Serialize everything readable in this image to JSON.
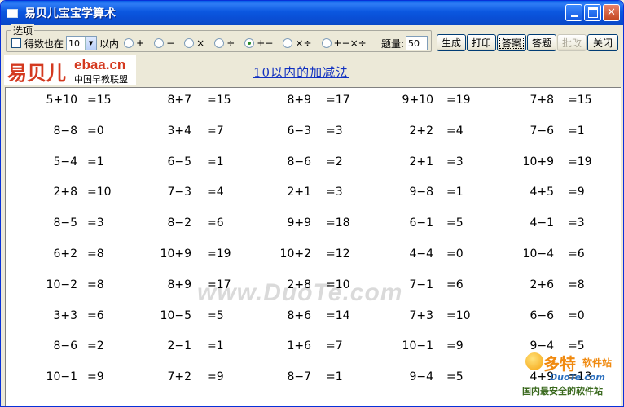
{
  "window": {
    "title": "易贝儿宝宝学算术"
  },
  "options": {
    "legend": "选项",
    "result_within_label": "得数也在",
    "limit_value": "10",
    "within_label": "以内",
    "ops": [
      {
        "label": "+",
        "selected": false
      },
      {
        "label": "−",
        "selected": false
      },
      {
        "label": "×",
        "selected": false
      },
      {
        "label": "÷",
        "selected": false
      },
      {
        "label": "+−",
        "selected": true
      },
      {
        "label": "×÷",
        "selected": false
      },
      {
        "label": "+−×÷",
        "selected": false
      }
    ],
    "count_label": "题量:",
    "count_value": "50"
  },
  "toolbar": {
    "generate": "生成",
    "print": "打印",
    "answer": "答案",
    "answer_questions": "答题",
    "grade": "批改",
    "close": "关闭"
  },
  "logo": {
    "cn": "易贝儿",
    "en": "ebaa.cn",
    "sub": "中国早教联盟"
  },
  "heading": "10以内的加减法",
  "problems": [
    [
      "5+10",
      "=15"
    ],
    [
      "8+7",
      "=15"
    ],
    [
      "8+9",
      "=17"
    ],
    [
      "9+10",
      "=19"
    ],
    [
      "7+8",
      "=15"
    ],
    [
      "8−8",
      "=0"
    ],
    [
      "3+4",
      "=7"
    ],
    [
      "6−3",
      "=3"
    ],
    [
      "2+2",
      "=4"
    ],
    [
      "7−6",
      "=1"
    ],
    [
      "5−4",
      "=1"
    ],
    [
      "6−5",
      "=1"
    ],
    [
      "8−6",
      "=2"
    ],
    [
      "2+1",
      "=3"
    ],
    [
      "10+9",
      "=19"
    ],
    [
      "2+8",
      "=10"
    ],
    [
      "7−3",
      "=4"
    ],
    [
      "2+1",
      "=3"
    ],
    [
      "9−8",
      "=1"
    ],
    [
      "4+5",
      "=9"
    ],
    [
      "8−5",
      "=3"
    ],
    [
      "8−2",
      "=6"
    ],
    [
      "9+9",
      "=18"
    ],
    [
      "6−1",
      "=5"
    ],
    [
      "4−1",
      "=3"
    ],
    [
      "6+2",
      "=8"
    ],
    [
      "10+9",
      "=19"
    ],
    [
      "10+2",
      "=12"
    ],
    [
      "4−4",
      "=0"
    ],
    [
      "10−4",
      "=6"
    ],
    [
      "10−2",
      "=8"
    ],
    [
      "8+9",
      "=17"
    ],
    [
      "2+8",
      "=10"
    ],
    [
      "7−1",
      "=6"
    ],
    [
      "2+6",
      "=8"
    ],
    [
      "3+3",
      "=6"
    ],
    [
      "10−5",
      "=5"
    ],
    [
      "8+6",
      "=14"
    ],
    [
      "7+3",
      "=10"
    ],
    [
      "6−6",
      "=0"
    ],
    [
      "8−6",
      "=2"
    ],
    [
      "2−1",
      "=1"
    ],
    [
      "1+6",
      "=7"
    ],
    [
      "10−1",
      "=9"
    ],
    [
      "9−4",
      "=5"
    ],
    [
      "10−1",
      "=9"
    ],
    [
      "7+2",
      "=9"
    ],
    [
      "8−7",
      "=1"
    ],
    [
      "9−4",
      "=5"
    ],
    [
      "4+9",
      "=13"
    ]
  ],
  "watermark": "www.DuoTe.com",
  "corner": {
    "top": "多特",
    "top_tail": "软件站",
    "mid": "DuoTe.com",
    "bottom": "国内最安全的软件站"
  }
}
